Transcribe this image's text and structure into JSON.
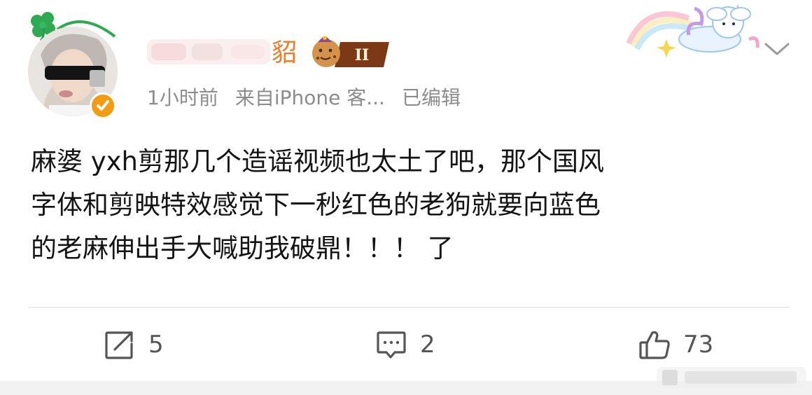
{
  "post": {
    "author": {
      "name_visible_part": "貂",
      "level_badge": "II",
      "verified_color": "#f39c12",
      "name_color": "#ee7a2a"
    },
    "meta": {
      "time": "1小时前",
      "source": "来自iPhone 客...",
      "edited": "已编辑"
    },
    "content_lines": [
      "麻婆 yxh剪那几个造谣视频也太土了吧，那个国风",
      "字体和剪映特效感觉下一秒红色的老狗就要向蓝色",
      "的老麻伸出手大喊助我破鼎！！！ 了"
    ]
  },
  "actions": {
    "share": {
      "icon": "share-icon",
      "count": "5"
    },
    "comment": {
      "icon": "comment-icon",
      "count": "2"
    },
    "like": {
      "icon": "thumbs-up-icon",
      "count": "73"
    }
  },
  "menu": {
    "icon": "chevron-down-icon"
  }
}
